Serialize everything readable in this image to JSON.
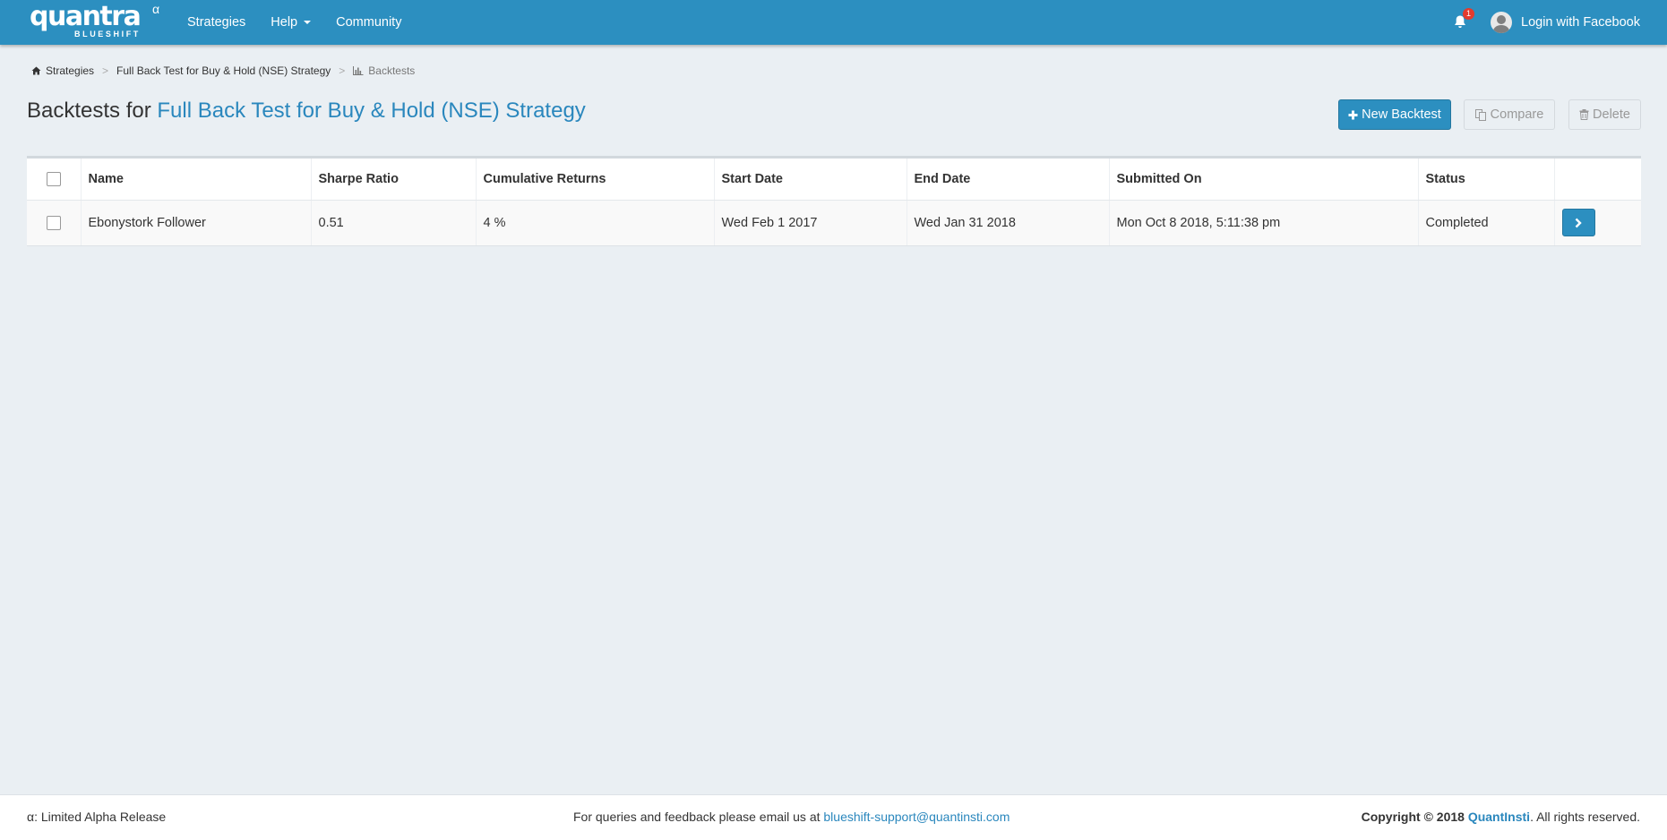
{
  "brand": {
    "wordmark": "quantra",
    "sub": "BLUESHIFT",
    "alpha": "α"
  },
  "nav": {
    "items": [
      {
        "label": "Strategies"
      },
      {
        "label": "Help"
      },
      {
        "label": "Community"
      }
    ],
    "notifications_count": "1",
    "login_label": "Login with Facebook"
  },
  "breadcrumb": [
    {
      "label": "Strategies",
      "icon": "home-icon"
    },
    {
      "label": "Full Back Test for Buy & Hold (NSE) Strategy"
    },
    {
      "label": "Backtests",
      "icon": "bar-chart-icon"
    }
  ],
  "title": {
    "prefix": "Backtests for",
    "strategy": "Full Back Test for Buy & Hold (NSE) Strategy"
  },
  "actions": {
    "new_backtest": "New Backtest",
    "compare": "Compare",
    "delete": "Delete"
  },
  "table": {
    "columns": [
      "Name",
      "Sharpe Ratio",
      "Cumulative Returns",
      "Start Date",
      "End Date",
      "Submitted On",
      "Status"
    ],
    "rows": [
      {
        "name": "Ebonystork Follower",
        "sharpe_ratio": "0.51",
        "cumulative_returns": "4 %",
        "start_date": "Wed Feb 1 2017",
        "end_date": "Wed Jan 31 2018",
        "submitted_on": "Mon Oct 8 2018, 5:11:38 pm",
        "status": "Completed"
      }
    ]
  },
  "footer": {
    "left": "α: Limited Alpha Release",
    "mid_text": "For queries and feedback please email us at",
    "email": "blueshift-support@quantinsti.com",
    "copyright": "Copyright © 2018",
    "company": "QuantInsti",
    "rights": ". All rights reserved."
  },
  "colors": {
    "navbar": "#2c8fc0",
    "link": "#2a87bd",
    "background": "#eaeff3",
    "badge": "#e33b2e"
  }
}
